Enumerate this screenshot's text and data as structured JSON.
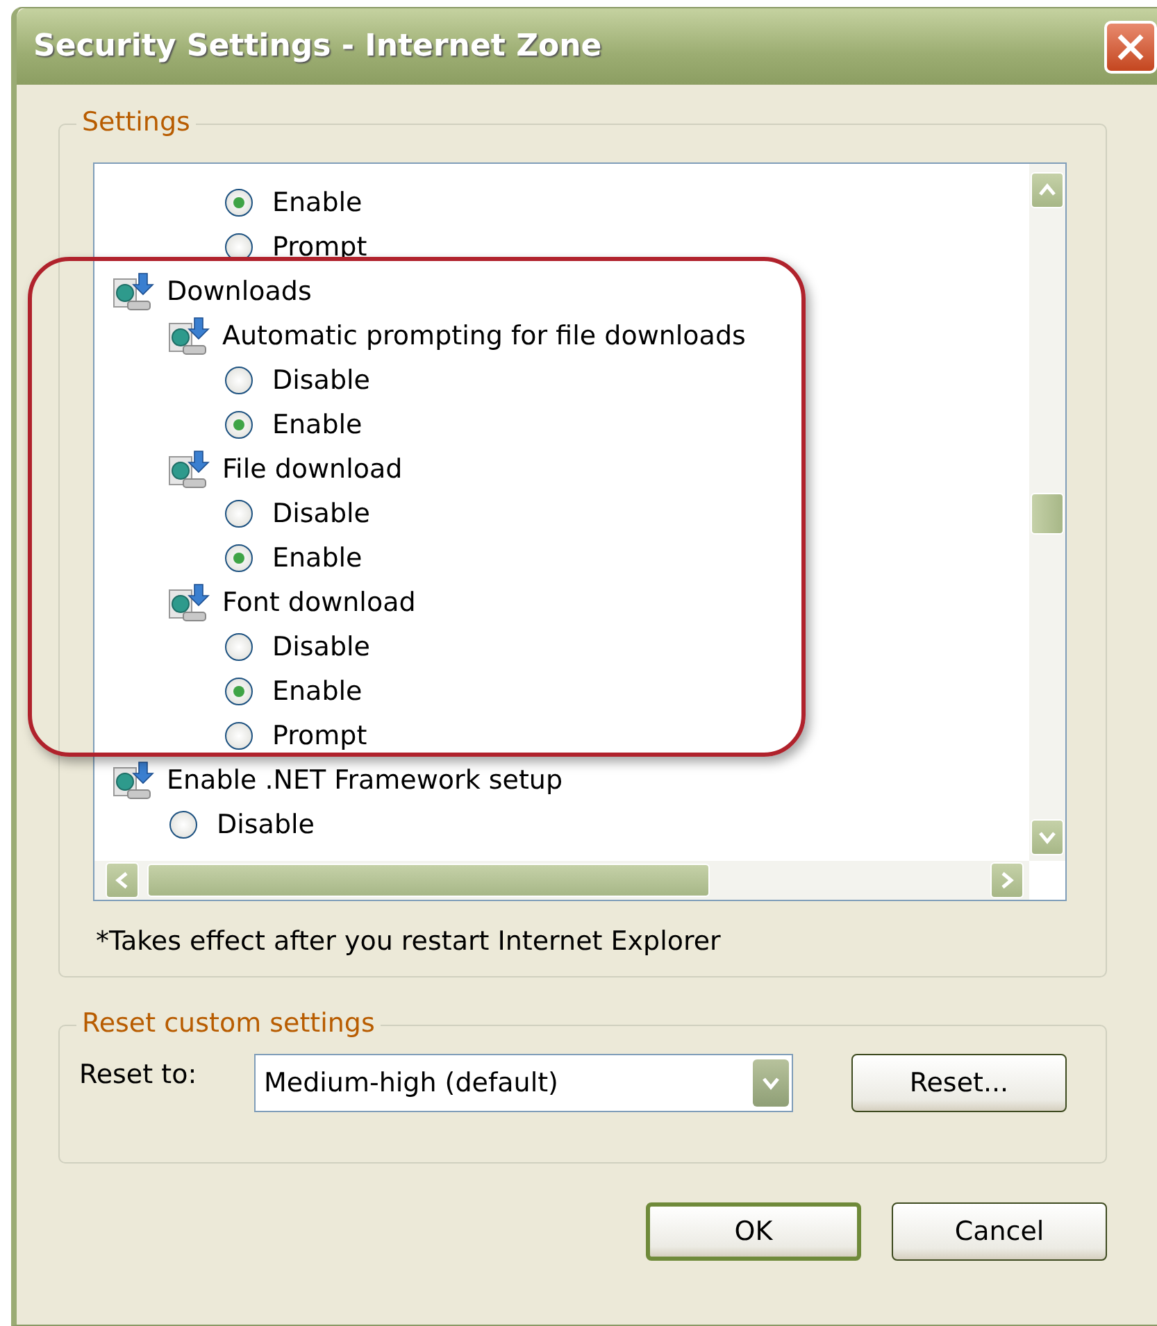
{
  "window": {
    "title": "Security Settings - Internet Zone"
  },
  "settings_group": {
    "label": "Settings",
    "tree": [
      {
        "kind": "group",
        "children": [
          {
            "kind": "group",
            "children": [
              {
                "kind": "radio",
                "label": "Enable",
                "selected": true
              },
              {
                "kind": "radio",
                "label": "Prompt",
                "selected": false
              }
            ]
          }
        ]
      },
      {
        "kind": "group",
        "label": "Downloads",
        "children": [
          {
            "kind": "group",
            "label": "Automatic prompting for file downloads",
            "children": [
              {
                "kind": "radio",
                "label": "Disable",
                "selected": false
              },
              {
                "kind": "radio",
                "label": "Enable",
                "selected": true
              }
            ]
          },
          {
            "kind": "group",
            "label": "File download",
            "children": [
              {
                "kind": "radio",
                "label": "Disable",
                "selected": false
              },
              {
                "kind": "radio",
                "label": "Enable",
                "selected": true
              }
            ]
          },
          {
            "kind": "group",
            "label": "Font download",
            "children": [
              {
                "kind": "radio",
                "label": "Disable",
                "selected": false
              },
              {
                "kind": "radio",
                "label": "Enable",
                "selected": true
              },
              {
                "kind": "radio",
                "label": "Prompt",
                "selected": false
              }
            ]
          }
        ]
      },
      {
        "kind": "group",
        "label": "Enable .NET Framework setup",
        "children": [
          {
            "kind": "radio",
            "label": "Disable",
            "selected": false
          }
        ]
      }
    ],
    "note": "*Takes effect after you restart Internet Explorer"
  },
  "reset_group": {
    "label": "Reset custom settings",
    "reset_to_label": "Reset to:",
    "dropdown": {
      "value": "Medium-high (default)"
    },
    "reset_button": "Reset..."
  },
  "buttons": [
    {
      "label": "OK",
      "default": true
    },
    {
      "label": "Cancel",
      "default": false
    }
  ]
}
